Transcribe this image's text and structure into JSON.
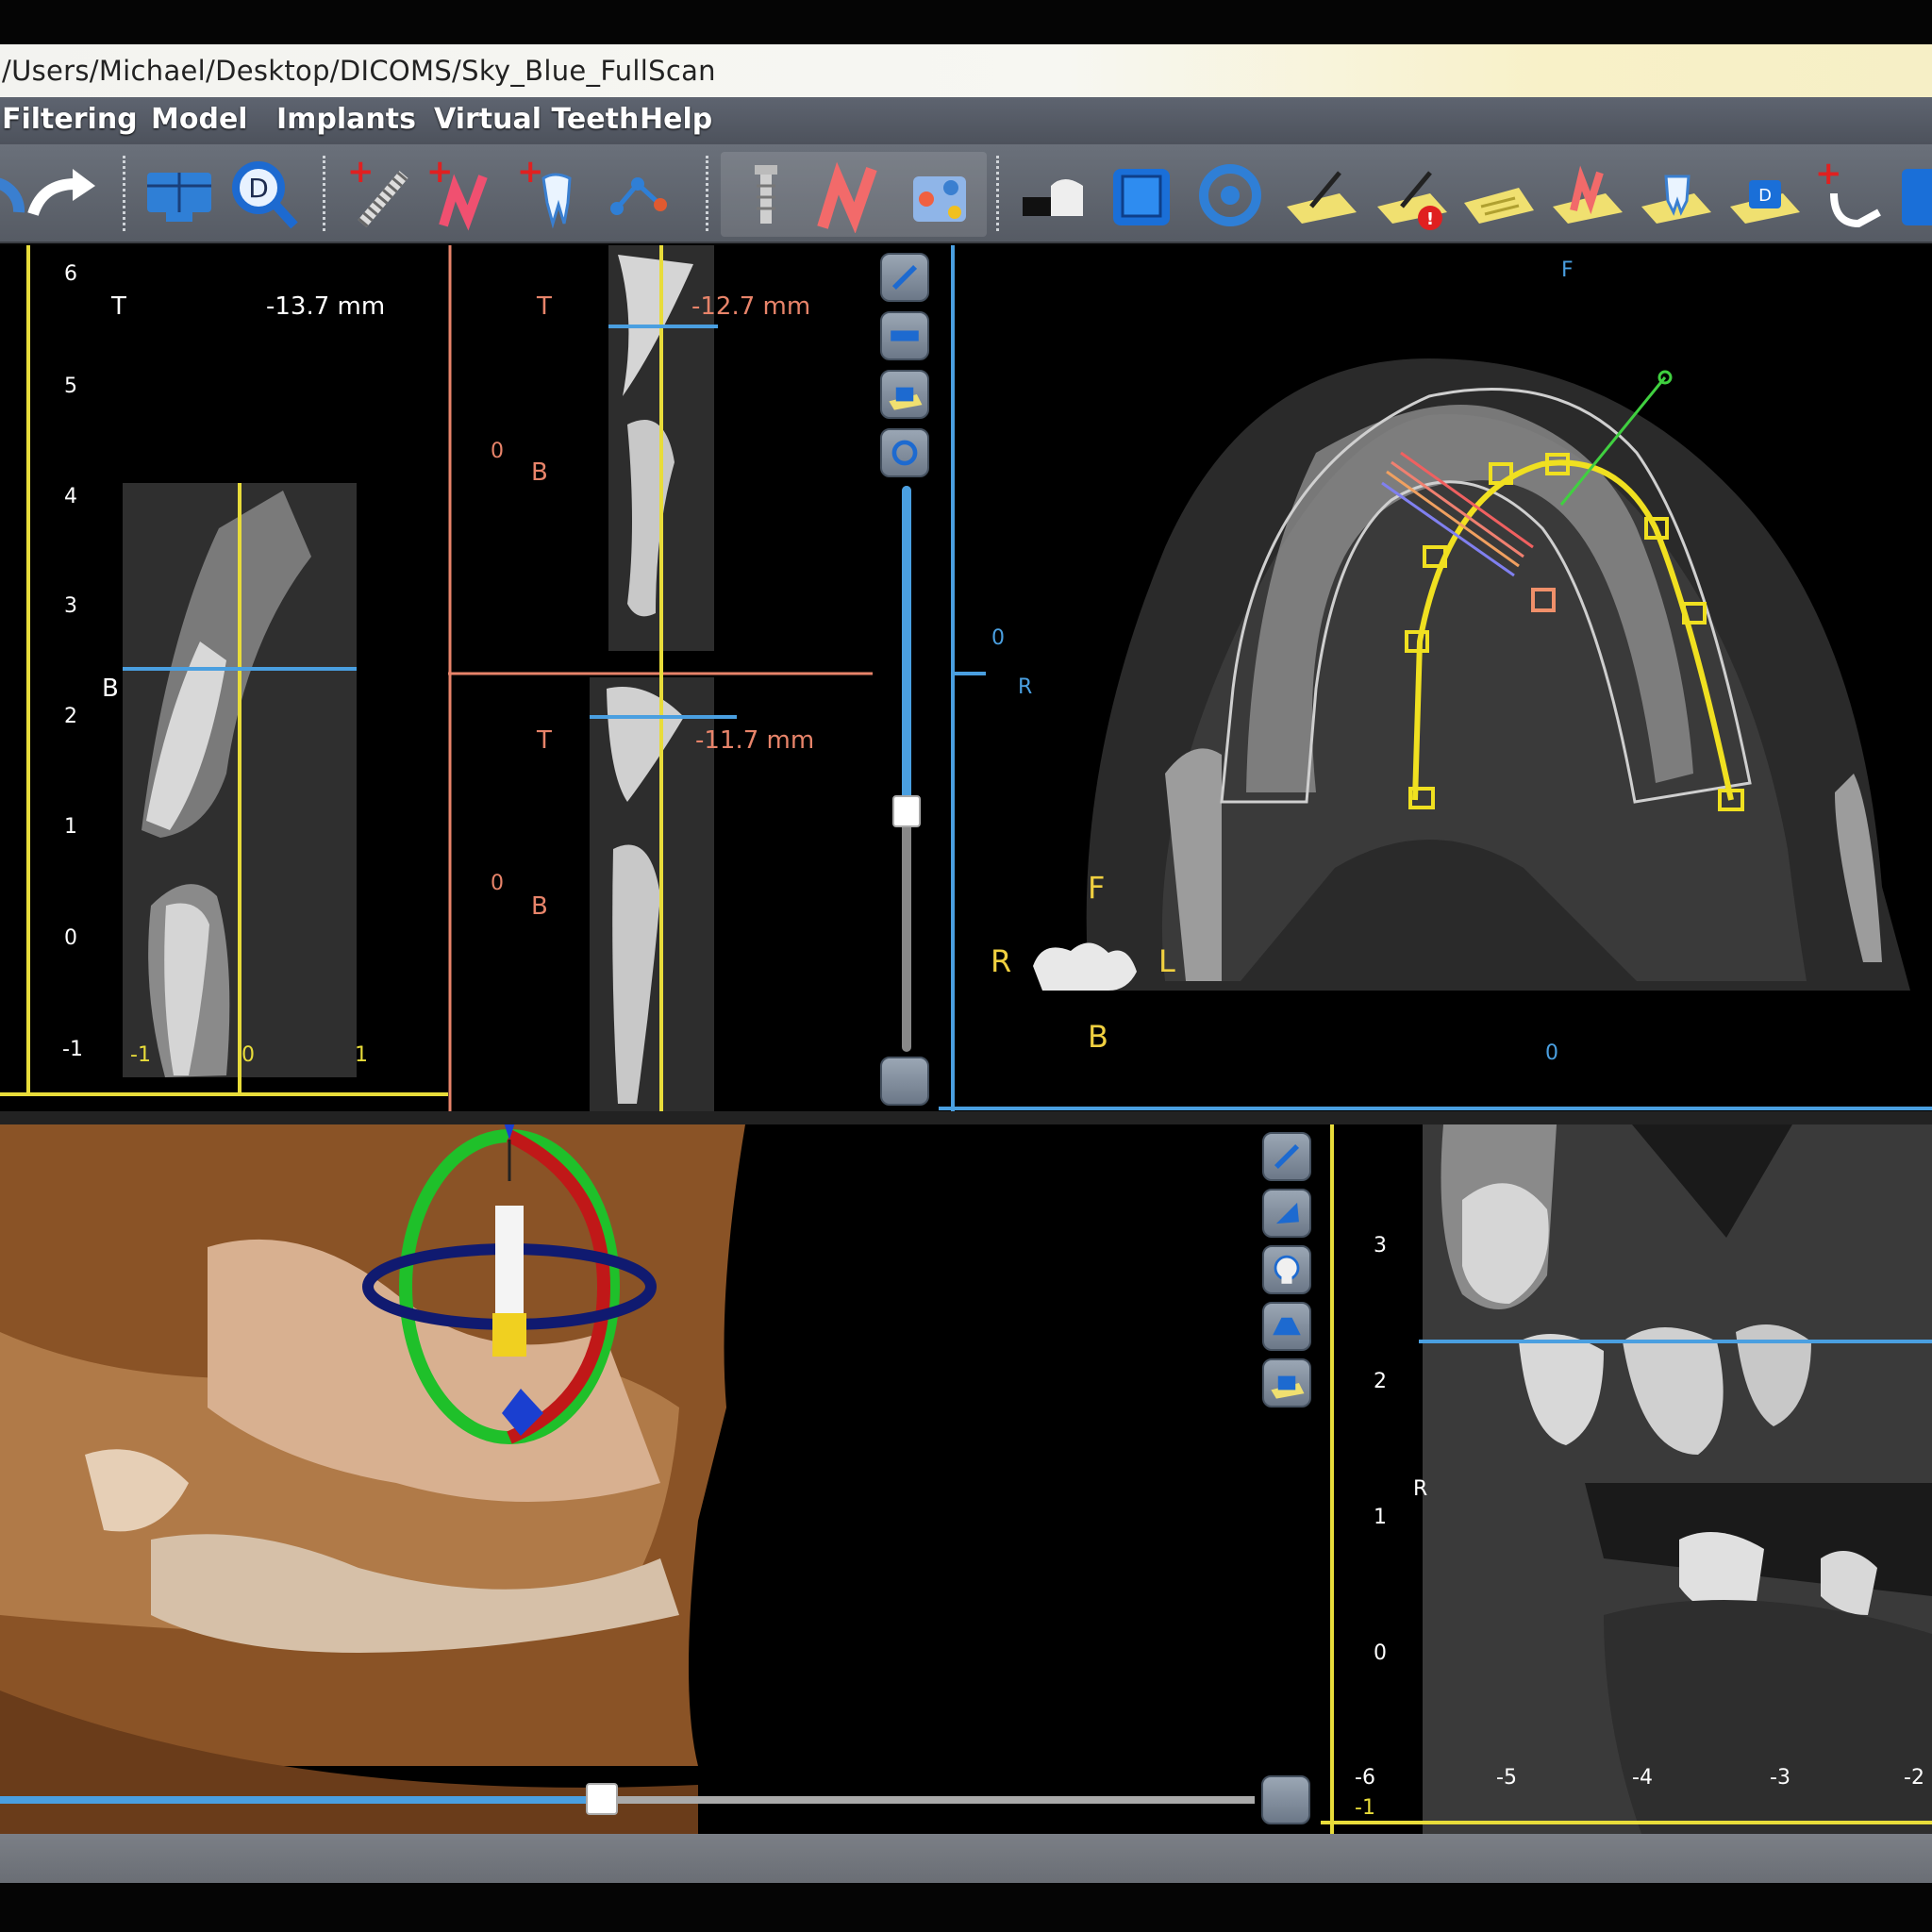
{
  "window": {
    "title_path": "/Users/Michael/Desktop/DICOMS/Sky_Blue_FullScan"
  },
  "menu": [
    {
      "label": "Filtering"
    },
    {
      "label": "Model"
    },
    {
      "label": "Implants"
    },
    {
      "label": "Virtual Teeth"
    },
    {
      "label": "Help"
    }
  ],
  "toolbar": {
    "icons": [
      "undo-icon",
      "redo-icon",
      "image-grid-icon",
      "zoom-icon",
      "add-implant-icon",
      "add-nerve-icon",
      "add-tooth-icon",
      "curve-points-icon",
      "implant-screw-icon",
      "nerve-icon",
      "model-cube-icon",
      "bone-model-icon",
      "cube-3d-icon",
      "skull-outline-icon",
      "measure-tool-icon",
      "measure-alert-icon",
      "note-icon",
      "nerve-note-icon",
      "tooth-note-icon",
      "scan-note-icon",
      "add-arch-icon",
      "more-icon"
    ]
  },
  "cross_section": {
    "top_label": "T",
    "bottom_label": "B",
    "depth": "-13.7 mm",
    "vertical_ticks": [
      "6",
      "5",
      "4",
      "3",
      "2",
      "1",
      "0",
      "-1"
    ],
    "horizontal_ticks": [
      "-1",
      "0",
      "1"
    ]
  },
  "slices": {
    "upper": {
      "top_label": "T",
      "bottom_label": "B",
      "depth": "-12.7 mm",
      "zero": "0"
    },
    "lower": {
      "top_label": "T",
      "bottom_label": "B",
      "depth": "-11.7 mm",
      "zero": "0"
    }
  },
  "axial": {
    "front_label": "F",
    "right_label": "R",
    "zero_y": "0",
    "zero_x": "0",
    "orientation": {
      "front": "F",
      "right": "R",
      "left": "L",
      "back": "B"
    }
  },
  "panoramic": {
    "right_label": "R",
    "vertical_ticks": [
      "3",
      "2",
      "1",
      "0"
    ],
    "horizontal_ticks": [
      "-6",
      "-5",
      "-4",
      "-3",
      "-2"
    ],
    "corner_tick": "-1"
  },
  "sliders": {
    "slice_slider_level": 0.58,
    "volume_slider_level": 0.48
  },
  "colors": {
    "accent_blue": "#4a9fe0",
    "ruler_yellow": "#e8dc3a",
    "ruler_salmon": "#e8846a",
    "arch_yellow": "#f0e020"
  }
}
